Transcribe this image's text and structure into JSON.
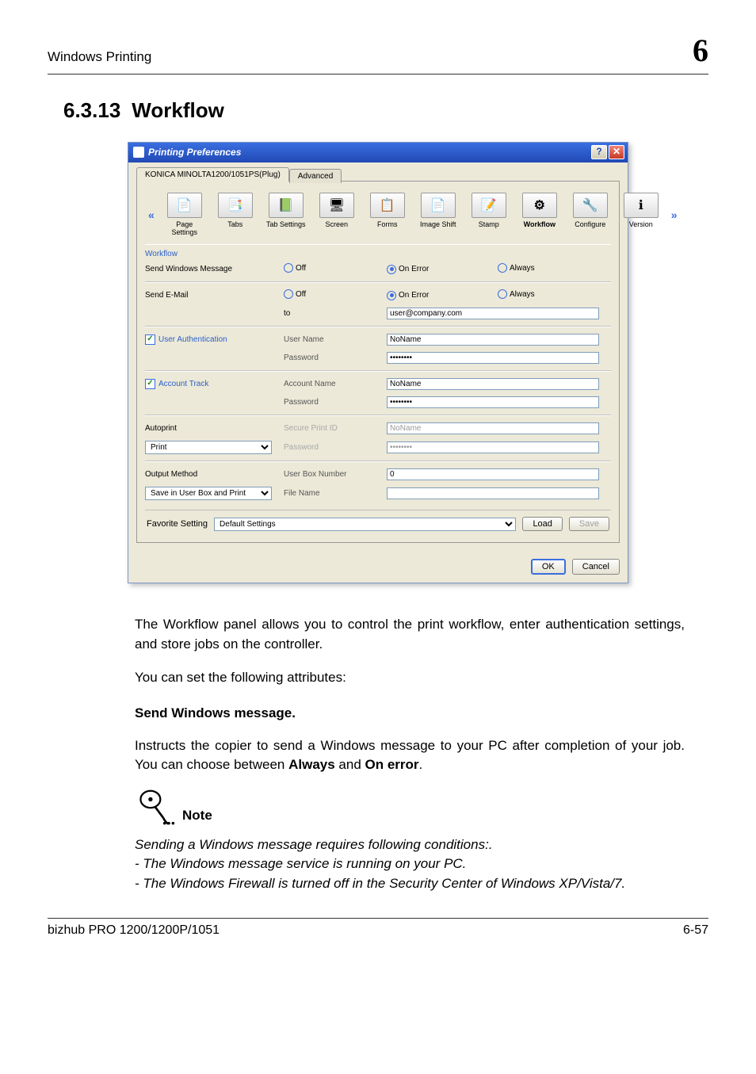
{
  "header": {
    "left": "Windows Printing",
    "chapter": "6"
  },
  "section": {
    "num": "6.3.13",
    "title": "Workflow"
  },
  "dialog": {
    "title": "Printing Preferences",
    "help_btn": "?",
    "close_btn": "✕",
    "tabs": {
      "active": "KONICA MINOLTA1200/1051PS(Plug)",
      "inactive": "Advanced"
    },
    "scroller": {
      "prev": "«",
      "next": "»",
      "items": [
        {
          "label": "Page Settings",
          "icon": "📄"
        },
        {
          "label": "Tabs",
          "icon": "📑"
        },
        {
          "label": "Tab Settings",
          "icon": "📗"
        },
        {
          "label": "Screen",
          "icon": "🖥"
        },
        {
          "label": "Forms",
          "icon": "📋"
        },
        {
          "label": "Image Shift",
          "icon": "📄"
        },
        {
          "label": "Stamp",
          "icon": "📝"
        },
        {
          "label": "Workflow",
          "icon": "⚙",
          "sel": true
        },
        {
          "label": "Configure",
          "icon": "🔧"
        },
        {
          "label": "Version",
          "icon": "ℹ"
        }
      ]
    },
    "workflow_label": "Workflow",
    "swm": {
      "label": "Send Windows Message",
      "off": "Off",
      "onerr": "On Error",
      "always": "Always",
      "sel": "onerr"
    },
    "email": {
      "label": "Send E-Mail",
      "off": "Off",
      "onerr": "On Error",
      "always": "Always",
      "sel": "onerr",
      "to_label": "to",
      "to_value": "user@company.com"
    },
    "auth": {
      "chk": "User Authentication",
      "checked": true,
      "user_label": "User Name",
      "user_value": "NoName",
      "pass_label": "Password",
      "pass_value": "••••••••"
    },
    "acct": {
      "chk": "Account Track",
      "checked": true,
      "name_label": "Account Name",
      "name_value": "NoName",
      "pass_label": "Password",
      "pass_value": "••••••••"
    },
    "auto": {
      "label": "Autoprint",
      "select": "Print",
      "id_label": "Secure Print ID",
      "id_value": "NoName",
      "pass_label": "Password",
      "pass_value": "••••••••"
    },
    "output": {
      "label": "Output Method",
      "select": "Save in User Box and Print",
      "box_label": "User Box Number",
      "box_value": "0",
      "file_label": "File Name",
      "file_value": ""
    },
    "fav": {
      "label": "Favorite Setting",
      "select": "Default Settings",
      "load": "Load",
      "save": "Save"
    },
    "ok": "OK",
    "cancel": "Cancel"
  },
  "body": {
    "p1": "The Workflow panel allows you to control the print workflow, enter authentication settings, and store jobs on the controller.",
    "p2": "You can set the following attributes:",
    "h4": "Send Windows message.",
    "p3a": "Instructs the copier to send a Windows message to your PC after completion of your job. You can choose between ",
    "p3b": "Always",
    "p3c": " and ",
    "p3d": "On error",
    "p3e": ".",
    "note_word": "Note",
    "n1": "Sending a Windows message requires following conditions:.",
    "n2": "- The Windows message service is running on your PC.",
    "n3": "- The Windows Firewall is turned off in the Security Center of Windows XP/Vista/7."
  },
  "footer": {
    "left": "bizhub PRO 1200/1200P/1051",
    "right": "6-57"
  }
}
